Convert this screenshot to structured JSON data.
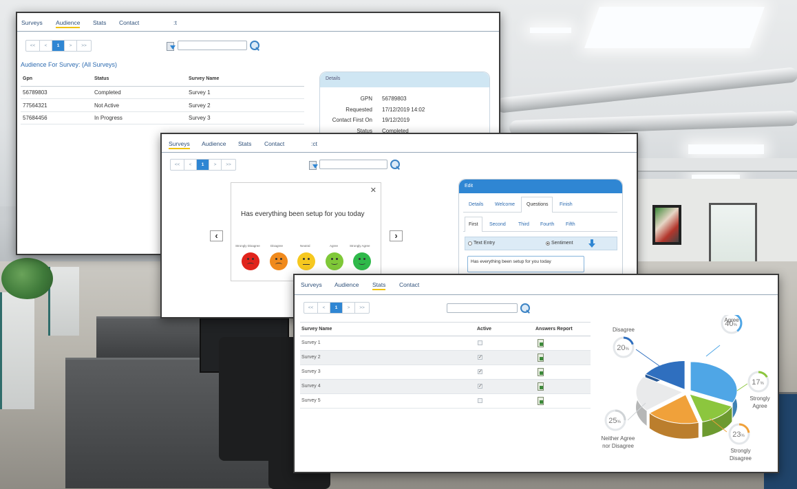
{
  "win1": {
    "nav": [
      "Surveys",
      "Audience",
      "Stats",
      "Contact",
      ":t"
    ],
    "pager": [
      "<<",
      "<",
      "1",
      ">",
      ">>"
    ],
    "title": "Audience For Survey: (All Surveys)",
    "columns": [
      "Gpn",
      "Status",
      "Survey Name"
    ],
    "rows": [
      [
        "56789803",
        "Completed",
        "Survey 1"
      ],
      [
        "77564321",
        "Not Active",
        "Survey 2"
      ],
      [
        "57684456",
        "In Progress",
        "Survey 3"
      ]
    ],
    "details": {
      "header": "Details",
      "labels": [
        "GPN",
        "Requested",
        "Contact First On",
        "Status"
      ],
      "values": [
        "56789803",
        "17/12/2019 14:02",
        "19/12/2019",
        "Completed"
      ]
    }
  },
  "win2": {
    "nav": [
      "Surveys",
      "Audience",
      "Stats",
      "Contact",
      ":ct"
    ],
    "pager": [
      "<<",
      "<",
      "1",
      ">",
      ">>"
    ],
    "question": "Has everything been setup for you today",
    "close": "✕",
    "prev": "‹",
    "next": "›",
    "scale": [
      "Strongly Disagree",
      "Disagree",
      "Neutral",
      "Agree",
      "Strongly Agree"
    ],
    "colors": [
      "#e0241c",
      "#f08a1c",
      "#f6c81f",
      "#7fc838",
      "#2fb94a"
    ],
    "edit": {
      "header": "Edit",
      "tabs": [
        "Details",
        "Welcome",
        "Questions",
        "Finish"
      ],
      "subtabs": [
        "First",
        "Second",
        "Third",
        "Fourth",
        "Fifth"
      ],
      "radio_text": "Text Entry",
      "radio_sentiment": "Sentiment",
      "input_value": "Has everything been setup for you today"
    }
  },
  "win3": {
    "nav": [
      "Surveys",
      "Audience",
      "Stats",
      "Contact"
    ],
    "pager": [
      "<<",
      "<",
      "1",
      ">",
      ">>"
    ],
    "columns": [
      "Survey Name",
      "Active",
      "Answers Report"
    ],
    "rows": [
      {
        "name": "Survey 1",
        "active": false
      },
      {
        "name": "Survey 2",
        "active": true
      },
      {
        "name": "Survey 3",
        "active": true
      },
      {
        "name": "Survey 4",
        "active": true
      },
      {
        "name": "Survey 5",
        "active": false
      }
    ]
  },
  "chart_data": {
    "type": "pie",
    "series": [
      {
        "label": "Agree",
        "value": 40,
        "display": "40",
        "color": "#4fa6e6"
      },
      {
        "label": "Strongly Agree",
        "value": 17,
        "display": "17",
        "color": "#8cc63e"
      },
      {
        "label": "Strongly Disagree",
        "value": 23,
        "display": "23",
        "color": "#f0a13a"
      },
      {
        "label": "Neither Agree nor Disagree",
        "value": 25,
        "display": "25",
        "color": "#e9eaeb"
      },
      {
        "label": "Disagree",
        "value": 20,
        "display": "20",
        "color": "#2f6fbf"
      }
    ],
    "label_lines": {
      "agree": "Agree",
      "disagree": "Disagree",
      "strongly_agree": [
        "Strongly",
        "Agree"
      ],
      "strongly_disagree": [
        "Strongly",
        "Disagree"
      ],
      "neither": [
        "Neither Agree",
        "nor Disagree"
      ]
    },
    "percent_sign": "%"
  }
}
